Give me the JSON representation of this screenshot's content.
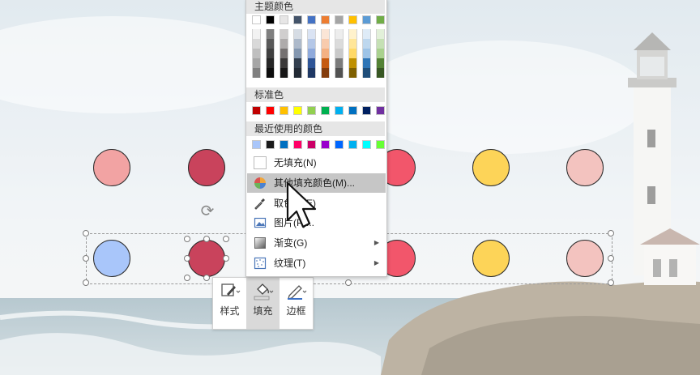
{
  "colors": {
    "circle_pink": "#f2a3a3",
    "circle_crimson": "#c9435c",
    "circle_red": "#f2566b",
    "circle_yellow": "#fdd458",
    "circle_rose": "#f3c3bf",
    "circle_blue": "#a9c6fa"
  },
  "menu": {
    "theme_colors_title": "主题颜色",
    "standard_colors_title": "标准色",
    "recent_colors_title": "最近使用的颜色",
    "theme_colors_top": [
      "#ffffff",
      "#000000",
      "#e7e6e6",
      "#44546a",
      "#4472c4",
      "#ed7d31",
      "#a5a5a5",
      "#ffc000",
      "#5b9bd5",
      "#70ad47"
    ],
    "theme_colors_shades": [
      [
        "#f2f2f2",
        "#d9d9d9",
        "#bfbfbf",
        "#a6a6a6",
        "#808080"
      ],
      [
        "#7f7f7f",
        "#595959",
        "#404040",
        "#262626",
        "#0d0d0d"
      ],
      [
        "#d0cece",
        "#aeabab",
        "#757171",
        "#3a3838",
        "#171616"
      ],
      [
        "#d6dce4",
        "#adb9ca",
        "#8497b0",
        "#333f4f",
        "#222a35"
      ],
      [
        "#dae3f3",
        "#b4c7e7",
        "#8faadc",
        "#2f5597",
        "#1f3864"
      ],
      [
        "#fbe5d6",
        "#f8cbad",
        "#f4b183",
        "#c55a11",
        "#843c0c"
      ],
      [
        "#ededed",
        "#dbdbdb",
        "#c9c9c9",
        "#7b7b7b",
        "#525252"
      ],
      [
        "#fff2cc",
        "#ffe699",
        "#ffd966",
        "#bf9000",
        "#7f6000"
      ],
      [
        "#deebf7",
        "#bdd7ee",
        "#9dc3e6",
        "#2e75b6",
        "#1f4e79"
      ],
      [
        "#e2f0d9",
        "#c5e0b4",
        "#a9d18e",
        "#548235",
        "#385723"
      ]
    ],
    "standard_colors": [
      "#c00000",
      "#ff0000",
      "#ffc000",
      "#ffff00",
      "#92d050",
      "#00b050",
      "#00b0f0",
      "#0070c0",
      "#002060",
      "#7030a0"
    ],
    "recent_colors": [
      "#a9c6fa",
      "#1a1a1a",
      "#0070c0",
      "#ff0066",
      "#cc0066",
      "#9900cc",
      "#0066ff",
      "#00b0f0",
      "#00ffff",
      "#66ff33"
    ],
    "items": [
      {
        "label": "无填充(N)",
        "icon": "no-fill-icon"
      },
      {
        "label": "其他填充颜色(M)...",
        "icon": "color-wheel-icon"
      },
      {
        "label": "取色器(E)",
        "icon": "eyedropper-icon"
      },
      {
        "label": "图片(P)...",
        "icon": "picture-icon"
      },
      {
        "label": "渐变(G)",
        "icon": "gradient-icon"
      },
      {
        "label": "纹理(T)",
        "icon": "texture-icon"
      }
    ]
  },
  "mini_toolbar": {
    "style_label": "样式",
    "fill_label": "填充",
    "border_label": "边框"
  }
}
